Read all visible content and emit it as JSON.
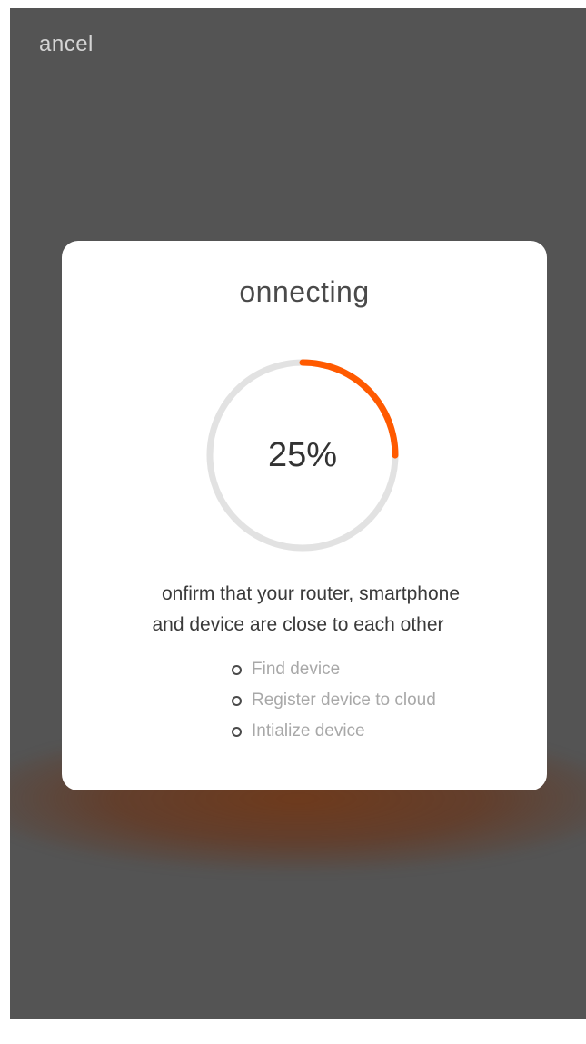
{
  "header": {
    "cancel_label": "ancel"
  },
  "dialog": {
    "title": "onnecting",
    "progress": {
      "value": 0.25,
      "label": "25%",
      "color": "#ff5a00",
      "track_color": "#e2e2e2"
    },
    "hint_line1": "onfirm that your router, smartphone",
    "hint_line2": "and device are close to each other",
    "steps": [
      {
        "label": "Find device",
        "icon": "circle-bullet-icon"
      },
      {
        "label": "Register device to cloud",
        "icon": "circle-bullet-icon"
      },
      {
        "label": "Intialize device",
        "icon": "circle-bullet-icon"
      }
    ]
  }
}
